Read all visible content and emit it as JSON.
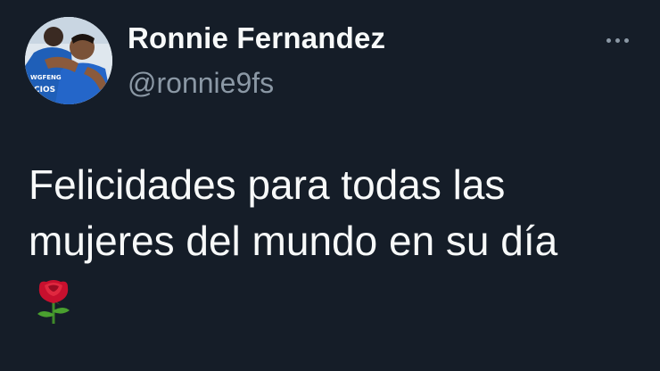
{
  "author": {
    "display_name": "Ronnie Fernandez",
    "handle": "@ronnie9fs",
    "avatar_icon": "profile-photo-player"
  },
  "tweet": {
    "text": "Felicidades para todas las\nmujeres del mundo en su día",
    "emoji": "rose-emoji"
  },
  "menu": {
    "icon": "more-dots-icon"
  },
  "colors": {
    "background": "#151d28",
    "primary_text": "#f7f9f9",
    "secondary_text": "#8b98a5"
  }
}
